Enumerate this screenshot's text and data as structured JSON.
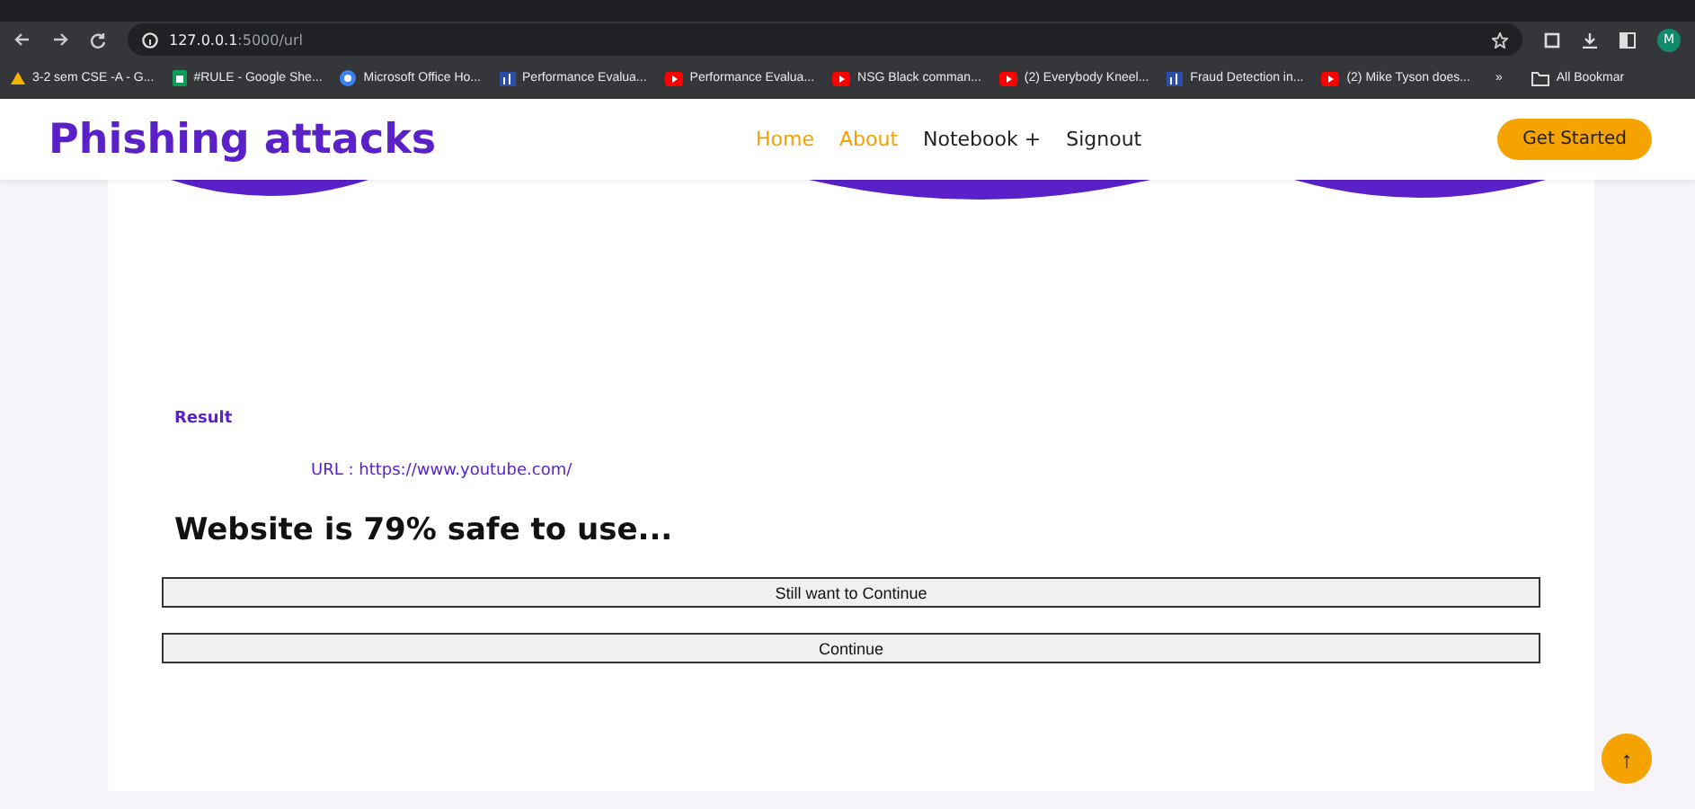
{
  "browser": {
    "url_host": "127.0.0.1",
    "url_path": ":5000/url",
    "bookmarks": [
      {
        "kind": "drive",
        "label": "3-2 sem CSE -A - G..."
      },
      {
        "kind": "sheet",
        "label": "#RULE - Google She..."
      },
      {
        "kind": "office",
        "label": "Microsoft Office Ho..."
      },
      {
        "kind": "report",
        "label": "Performance Evalua..."
      },
      {
        "kind": "video",
        "label": "Performance Evalua..."
      },
      {
        "kind": "video",
        "label": "NSG Black comman..."
      },
      {
        "kind": "video",
        "label": "(2) Everybody Kneel..."
      },
      {
        "kind": "report",
        "label": "Fraud Detection in..."
      },
      {
        "kind": "video",
        "label": "(2) Mike Tyson does..."
      }
    ],
    "overflow": "»",
    "all_bookmarks": "All Bookmar",
    "avatar": "M"
  },
  "navbar": {
    "brand": "Phishing attacks",
    "links": [
      {
        "label": "Home",
        "selected": true
      },
      {
        "label": "About",
        "selected": true
      },
      {
        "label": "Notebook +",
        "selected": false
      },
      {
        "label": "Signout",
        "selected": false
      }
    ],
    "cta": "Get Started"
  },
  "result": {
    "heading": "Result",
    "url": "URL : https://www.youtube.com/",
    "verdict": "Website is 79% safe to use...",
    "buttons": [
      "Still want to Continue",
      "Continue"
    ]
  },
  "back_to_top": "↑"
}
